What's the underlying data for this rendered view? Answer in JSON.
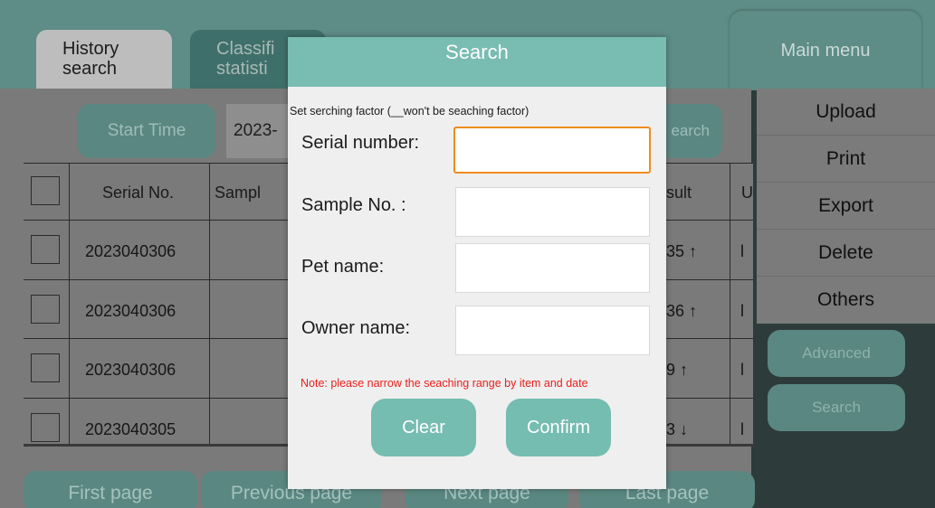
{
  "tabs": [
    {
      "line1": "History",
      "line2": "search",
      "active": true
    },
    {
      "line1": "Classifi",
      "line2": "statisti",
      "active": false
    }
  ],
  "main_menu_label": "Main menu",
  "filters": {
    "start_time_label": "Start Time",
    "start_date_value": "2023-",
    "search_label": "earch"
  },
  "table": {
    "headers": [
      "Serial No.",
      "Sampl",
      "sult",
      "U"
    ],
    "rows": [
      {
        "serial": "2023040306",
        "result": "35",
        "arrow": "↑",
        "unit": "l"
      },
      {
        "serial": "2023040306",
        "result": "36",
        "arrow": "↑",
        "unit": "l"
      },
      {
        "serial": "2023040306",
        "result": "9",
        "arrow": "↑",
        "unit": "l"
      },
      {
        "serial": "2023040305",
        "result": "3",
        "arrow": "↓",
        "unit": "l"
      }
    ]
  },
  "right_menu": {
    "upload": "Upload",
    "print": "Print",
    "export": "Export",
    "delete": "Delete",
    "others": "Others",
    "advanced": "Advanced",
    "search": "Search"
  },
  "pagination": {
    "first": "First page",
    "previous": "Previous page",
    "next": "Next page",
    "last": "Last page"
  },
  "dialog": {
    "title": "Search",
    "hint": "Set serching factor (__won't be seaching factor)",
    "fields": {
      "serial_label": "Serial number:",
      "serial_value": "",
      "sample_label": "Sample No. :",
      "sample_value": "",
      "pet_label": "Pet name:",
      "pet_value": "",
      "owner_label": "Owner name:",
      "owner_value": ""
    },
    "note": "Note: please narrow the seaching range by item and date",
    "clear_label": "Clear",
    "confirm_label": "Confirm"
  },
  "colors": {
    "accent_teal": "#79bcb1",
    "focus_orange": "#f08c1c",
    "note_red": "#e9201d"
  }
}
